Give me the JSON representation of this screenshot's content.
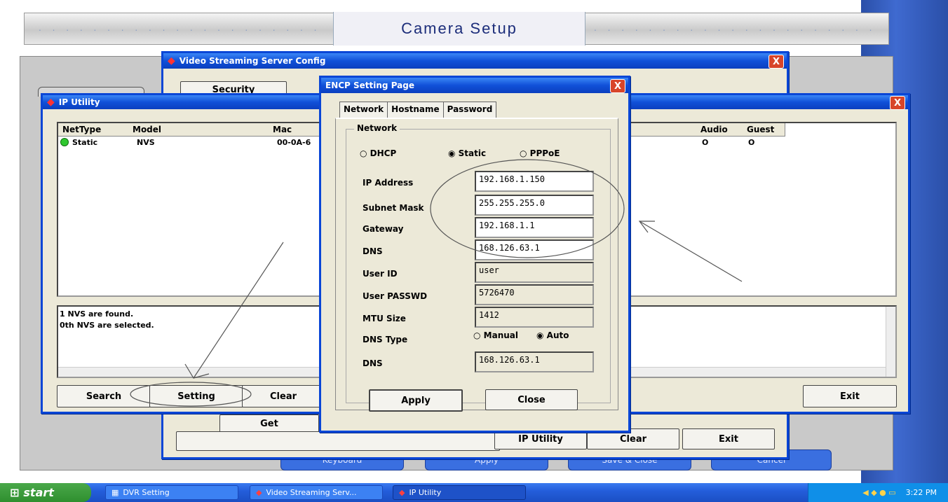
{
  "banner": {
    "title": "Camera Setup",
    "dots": ". . . . . . . . . . . . . . . . . . . . . ."
  },
  "setup_bottom_buttons": [
    "Keyboard",
    "Apply",
    "Save & Close",
    "Cancel"
  ],
  "vss_window": {
    "title": "Video Streaming Server Config",
    "close": "X",
    "tab_security": "Security",
    "get_button": "Get",
    "ip_utility_button": "IP Utility",
    "clear_button": "Clear",
    "exit_button": "Exit"
  },
  "ip_utility": {
    "title": "IP Utility",
    "close": "X",
    "columns": {
      "nettype": "NetType",
      "model": "Model",
      "mac": "Mac",
      "audio": "Audio",
      "guest": "Guest"
    },
    "row": {
      "nettype": "Static",
      "model": "NVS",
      "mac": "00-0A-6",
      "audio": "O",
      "guest": "O"
    },
    "status_lines": [
      "1 NVS are found.",
      "0th NVS are selected."
    ],
    "search_button": "Search",
    "setting_button": "Setting",
    "clear_button": "Clear",
    "exit_button": "Exit"
  },
  "encp": {
    "title": "ENCP Setting Page",
    "close": "X",
    "tabs": [
      "Network",
      "Hostname",
      "Password"
    ],
    "group_label": "Network",
    "mode_options": [
      "DHCP",
      "Static",
      "PPPoE"
    ],
    "selected_mode": "Static",
    "labels": {
      "ip": "IP Address",
      "subnet": "Subnet Mask",
      "gateway": "Gateway",
      "dns": "DNS",
      "user_id": "User ID",
      "user_passwd": "User PASSWD",
      "mtu": "MTU Size",
      "dns_type": "DNS Type",
      "dns2": "DNS"
    },
    "values": {
      "ip": "192.168.1.150",
      "subnet": "255.255.255.0",
      "gateway": "192.168.1.1",
      "dns": "168.126.63.1",
      "user_id": "user",
      "user_passwd": "5726470",
      "mtu": "1412",
      "dns2": "168.126.63.1"
    },
    "dns_type_options": [
      "Manual",
      "Auto"
    ],
    "selected_dns_type": "Auto",
    "apply_button": "Apply",
    "close_button": "Close"
  },
  "taskbar": {
    "start": "start",
    "tasks": [
      "DVR Setting",
      "Video Streaming Serv...",
      "IP Utility"
    ],
    "clock": "3:22 PM"
  },
  "colors": {
    "xp_blue": "#0a46d6",
    "taskbar": "#245edb",
    "annotation": "#555555"
  }
}
